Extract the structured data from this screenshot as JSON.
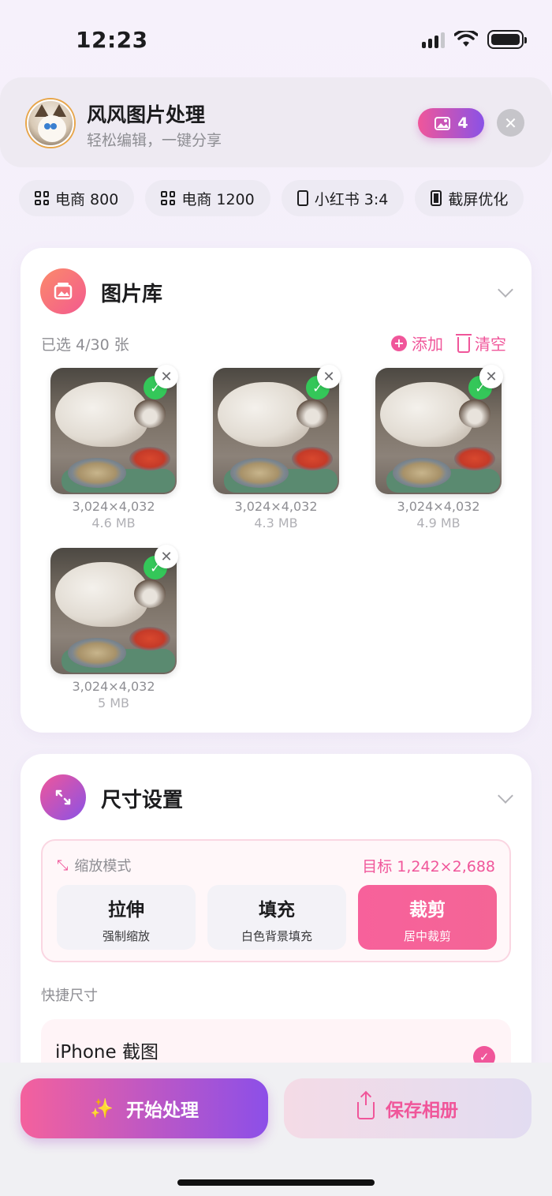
{
  "status_bar": {
    "time": "12:23"
  },
  "header": {
    "title": "风风图片处理",
    "subtitle": "轻松编辑，一键分享",
    "badge_count": "4",
    "close_symbol": "✕"
  },
  "presets": [
    {
      "label": "电商 800",
      "icon": "grid-icon"
    },
    {
      "label": "电商 1200",
      "icon": "grid-icon"
    },
    {
      "label": "小红书 3:4",
      "icon": "phone-outline-icon"
    },
    {
      "label": "截屏优化",
      "icon": "phone-icon"
    }
  ],
  "library": {
    "title": "图片库",
    "selected_text": "已选 4/30 张",
    "add_label": "添加",
    "clear_label": "清空",
    "images": [
      {
        "dims": "3,024×4,032",
        "size": "4.6 MB"
      },
      {
        "dims": "3,024×4,032",
        "size": "4.3 MB"
      },
      {
        "dims": "3,024×4,032",
        "size": "4.9 MB"
      },
      {
        "dims": "3,024×4,032",
        "size": "5 MB"
      }
    ]
  },
  "size_settings": {
    "title": "尺寸设置",
    "mode_label": "缩放模式",
    "target": "目标 1,242×2,688",
    "modes": [
      {
        "title": "拉伸",
        "sub": "强制缩放",
        "active": false
      },
      {
        "title": "填充",
        "sub": "白色背景填充",
        "active": false
      },
      {
        "title": "裁剪",
        "sub": "居中裁剪",
        "active": true
      }
    ],
    "quick_label": "快捷尺寸",
    "quick_items": [
      {
        "title": "iPhone 截图",
        "selected": true
      }
    ]
  },
  "actions": {
    "start": "开始处理",
    "save": "保存相册"
  },
  "colors": {
    "accent_pink": "#f0569a",
    "accent_purple": "#8a52e6",
    "check_green": "#34c759"
  }
}
